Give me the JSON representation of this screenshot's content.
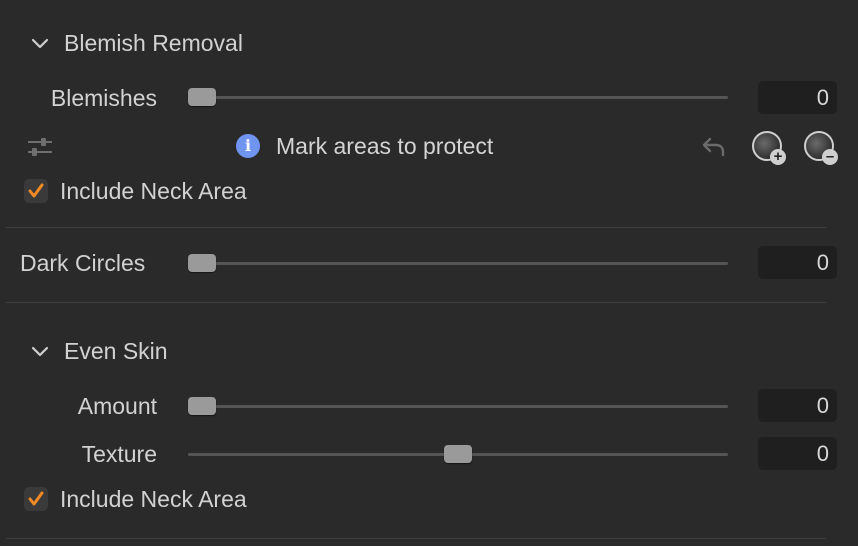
{
  "blemish": {
    "title": "Blemish Removal",
    "slider_label": "Blemishes",
    "value": "0",
    "hint": "Mark areas to protect",
    "neck_label": "Include Neck Area",
    "neck_checked": true
  },
  "dark_circles": {
    "label": "Dark Circles",
    "value": "0"
  },
  "even_skin": {
    "title": "Even Skin",
    "amount_label": "Amount",
    "amount_value": "0",
    "texture_label": "Texture",
    "texture_value": "0",
    "neck_label": "Include Neck Area",
    "neck_checked": true
  },
  "colors": {
    "background": "#2a2a2a",
    "accent_check": "#f08a24",
    "info": "#6f95f1"
  },
  "icons": [
    "chevron-down-icon",
    "sliders-icon",
    "info-icon",
    "undo-icon",
    "add-brush-icon",
    "subtract-brush-icon",
    "checkmark-icon"
  ]
}
